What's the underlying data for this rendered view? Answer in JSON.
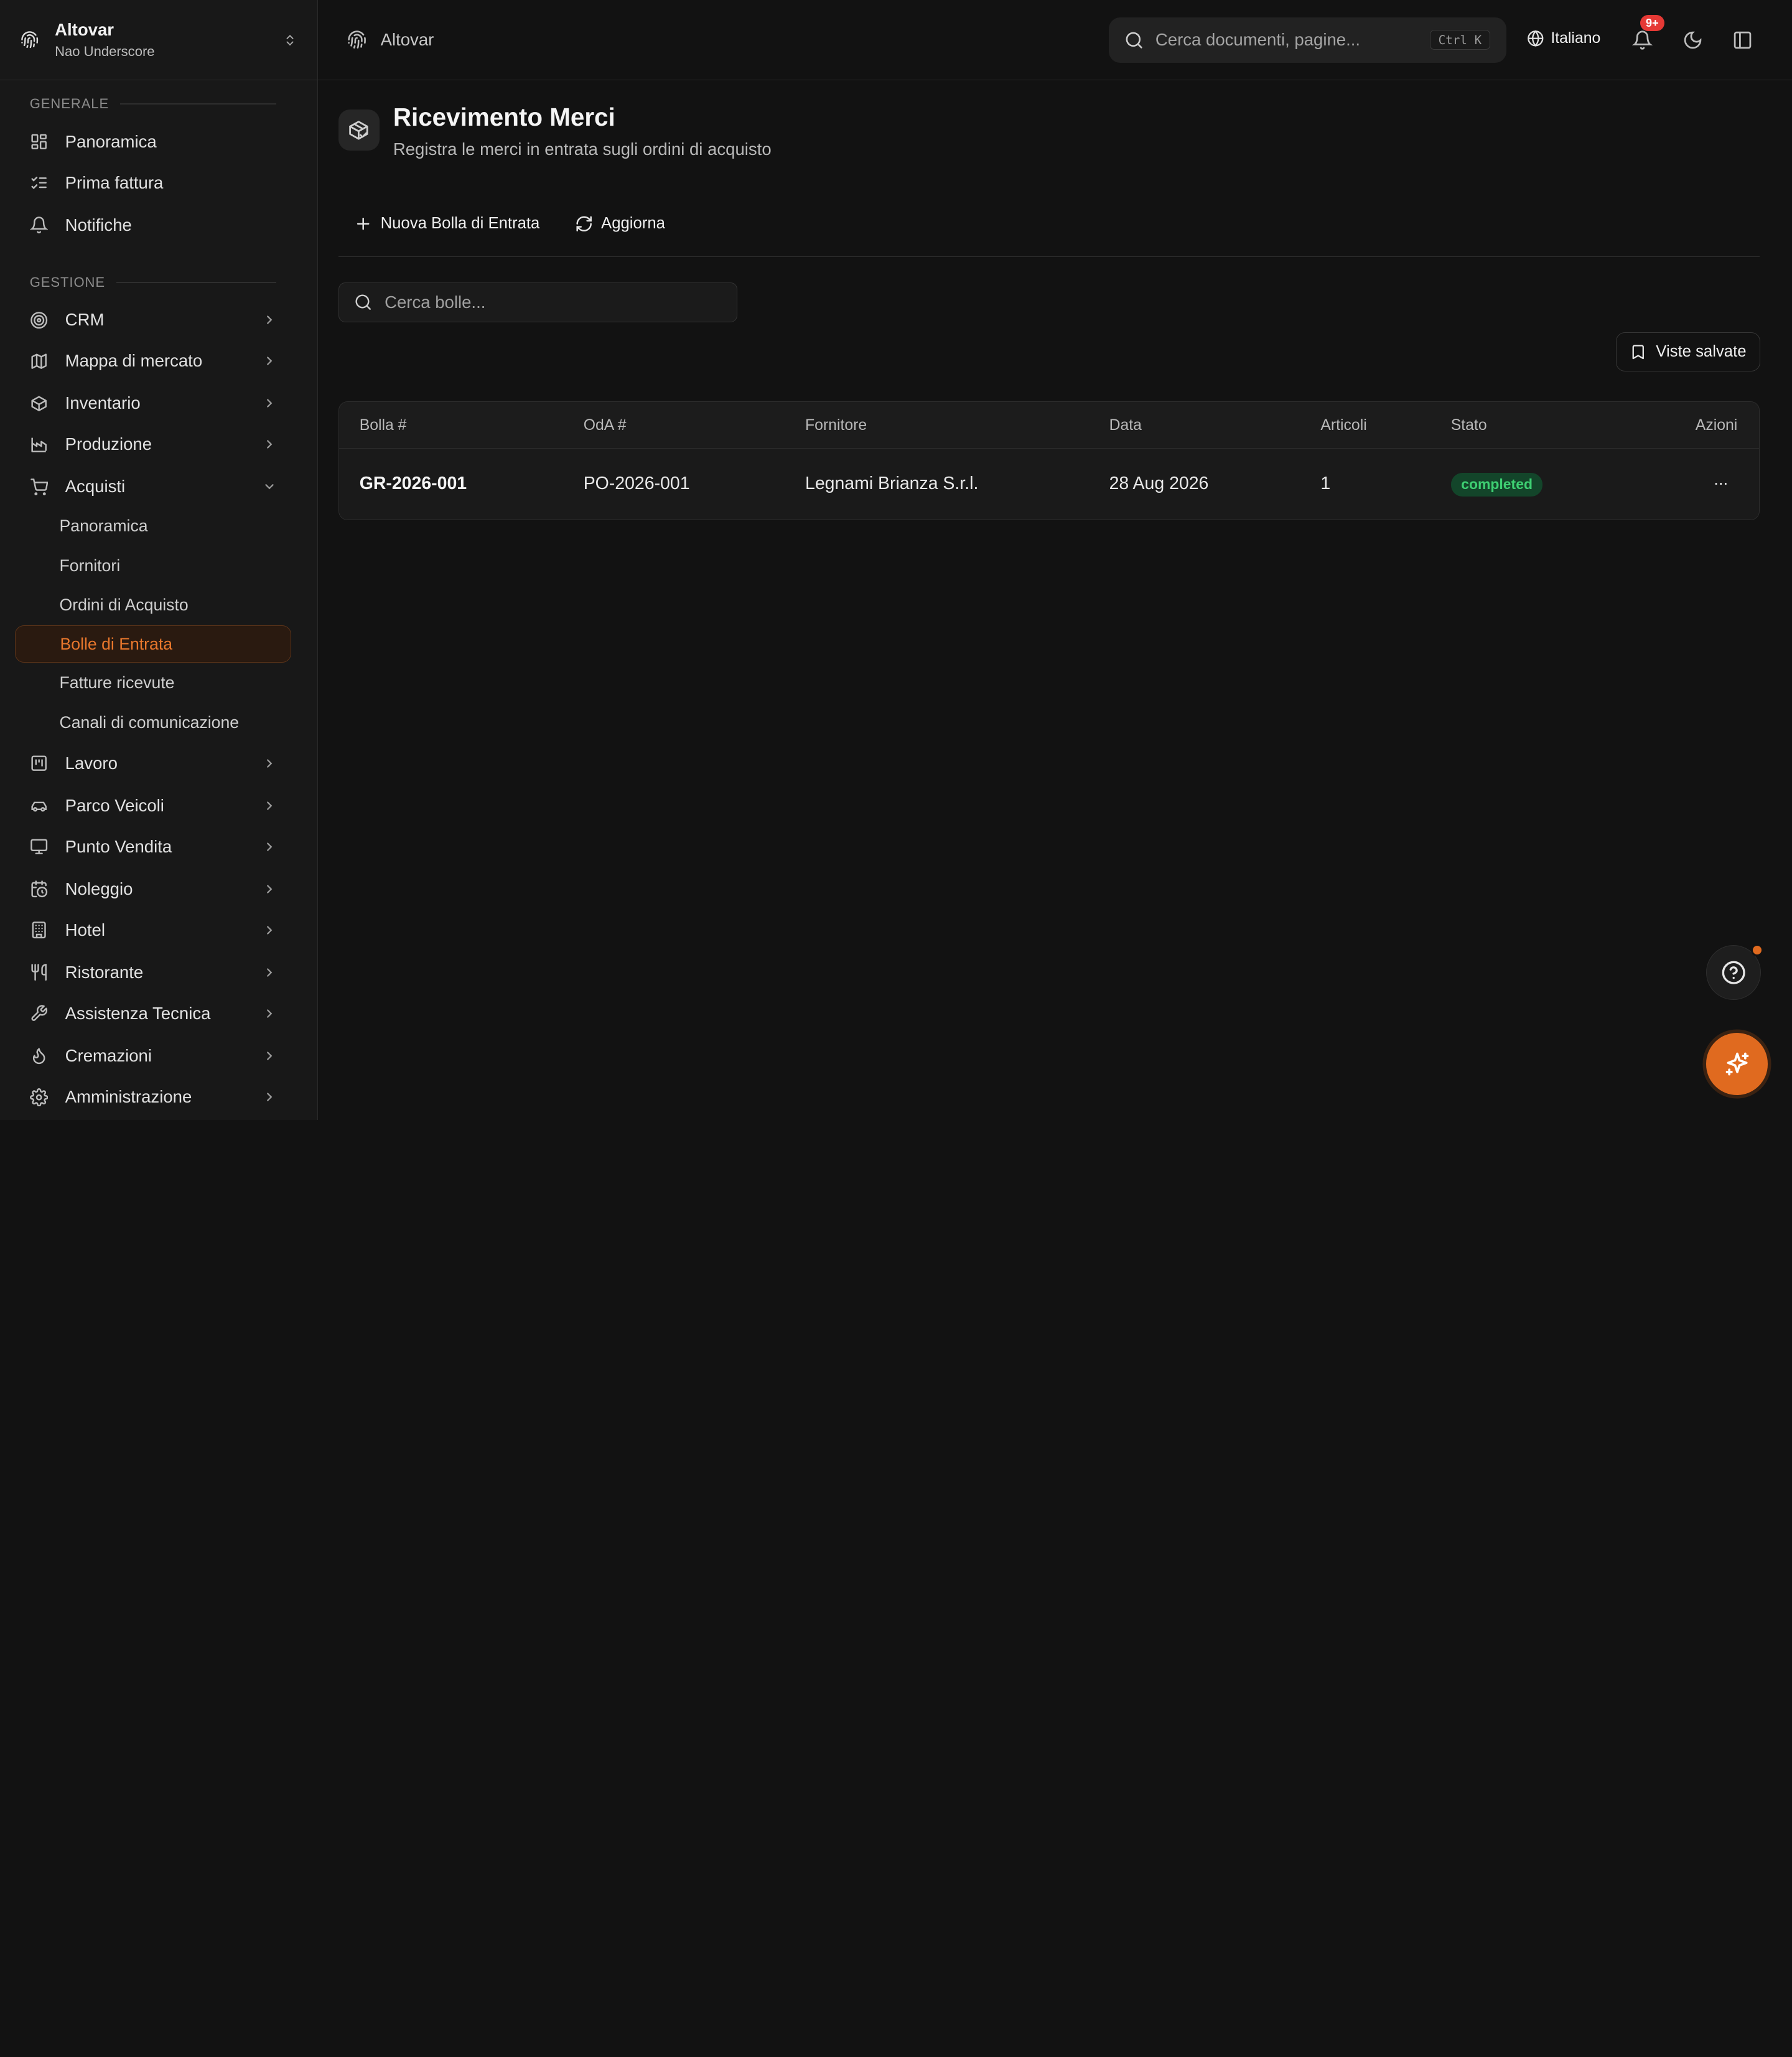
{
  "brand": {
    "title": "Altovar",
    "subtitle": "Nao Underscore"
  },
  "sidebar": {
    "section_general": "GENERALE",
    "section_management": "GESTIONE",
    "general_items": [
      {
        "label": "Panoramica",
        "icon": "dashboard-icon"
      },
      {
        "label": "Prima fattura",
        "icon": "checklist-icon"
      },
      {
        "label": "Notifiche",
        "icon": "bell-icon"
      }
    ],
    "management_items": [
      {
        "label": "CRM",
        "icon": "target-icon"
      },
      {
        "label": "Mappa di mercato",
        "icon": "map-icon"
      },
      {
        "label": "Inventario",
        "icon": "package-icon"
      },
      {
        "label": "Produzione",
        "icon": "factory-icon"
      },
      {
        "label": "Acquisti",
        "icon": "cart-icon",
        "expanded": true
      },
      {
        "label": "Lavoro",
        "icon": "kanban-icon"
      },
      {
        "label": "Parco Veicoli",
        "icon": "car-icon"
      },
      {
        "label": "Punto Vendita",
        "icon": "monitor-icon"
      },
      {
        "label": "Noleggio",
        "icon": "calendar-clock-icon"
      },
      {
        "label": "Hotel",
        "icon": "building-icon"
      },
      {
        "label": "Ristorante",
        "icon": "utensils-icon"
      },
      {
        "label": "Assistenza Tecnica",
        "icon": "wrench-icon"
      },
      {
        "label": "Cremazioni",
        "icon": "flame-icon"
      },
      {
        "label": "Amministrazione",
        "icon": "gear-icon"
      }
    ],
    "acquisti_sub": [
      "Panoramica",
      "Fornitori",
      "Ordini di Acquisto",
      "Bolle di Entrata",
      "Fatture ricevute",
      "Canali di comunicazione"
    ],
    "active_sub": "Bolle di Entrata"
  },
  "topbar": {
    "breadcrumb": "Altovar",
    "search_placeholder": "Cerca documenti, pagine...",
    "shortcut": "Ctrl K",
    "language": "Italiano",
    "notif_badge": "9+"
  },
  "page": {
    "title": "Ricevimento Merci",
    "subtitle": "Registra le merci in entrata sugli ordini di acquisto",
    "new_button": "Nuova Bolla di Entrata",
    "refresh_button": "Aggiorna",
    "search_placeholder": "Cerca bolle...",
    "saved_views": "Viste salvate"
  },
  "table": {
    "headers": [
      "Bolla #",
      "OdA #",
      "Fornitore",
      "Data",
      "Articoli",
      "Stato",
      "Azioni"
    ],
    "rows": [
      {
        "bolla": "GR-2026-001",
        "oda": "PO-2026-001",
        "fornitore": "Legnami Brianza S.r.l.",
        "data": "28 Aug 2026",
        "articoli": "1",
        "stato": "completed",
        "azioni": "..."
      }
    ]
  },
  "colors": {
    "accent": "#e06a1f",
    "status_completed": "#3ecf72",
    "background": "#121212"
  }
}
